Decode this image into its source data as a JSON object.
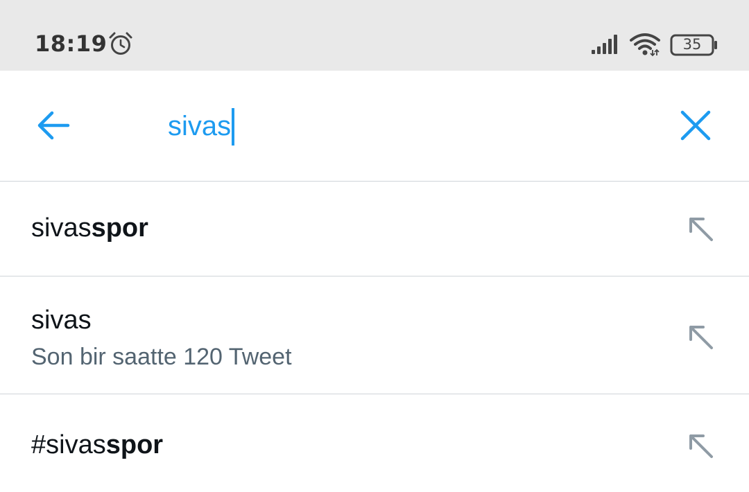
{
  "status_bar": {
    "time": "18:19",
    "battery": "35",
    "icons": [
      "alarm-icon",
      "signal-icon",
      "wifi-icon",
      "battery-icon"
    ]
  },
  "search": {
    "value": "sivas",
    "back_icon": "arrow-left-icon",
    "clear_icon": "close-icon",
    "accent_color": "#1d9bf0"
  },
  "suggestions": [
    {
      "prefix": "sivas",
      "bold": "spor",
      "subtitle": ""
    },
    {
      "prefix": "sivas",
      "bold": "",
      "subtitle": "Son bir saatte 120 Tweet"
    },
    {
      "prefix": "#sivas",
      "bold": "spor",
      "subtitle": ""
    }
  ],
  "colors": {
    "text_primary": "#0f1419",
    "text_secondary": "#536471",
    "divider": "#cfd4d8",
    "status_bg": "#e9e9e9"
  }
}
